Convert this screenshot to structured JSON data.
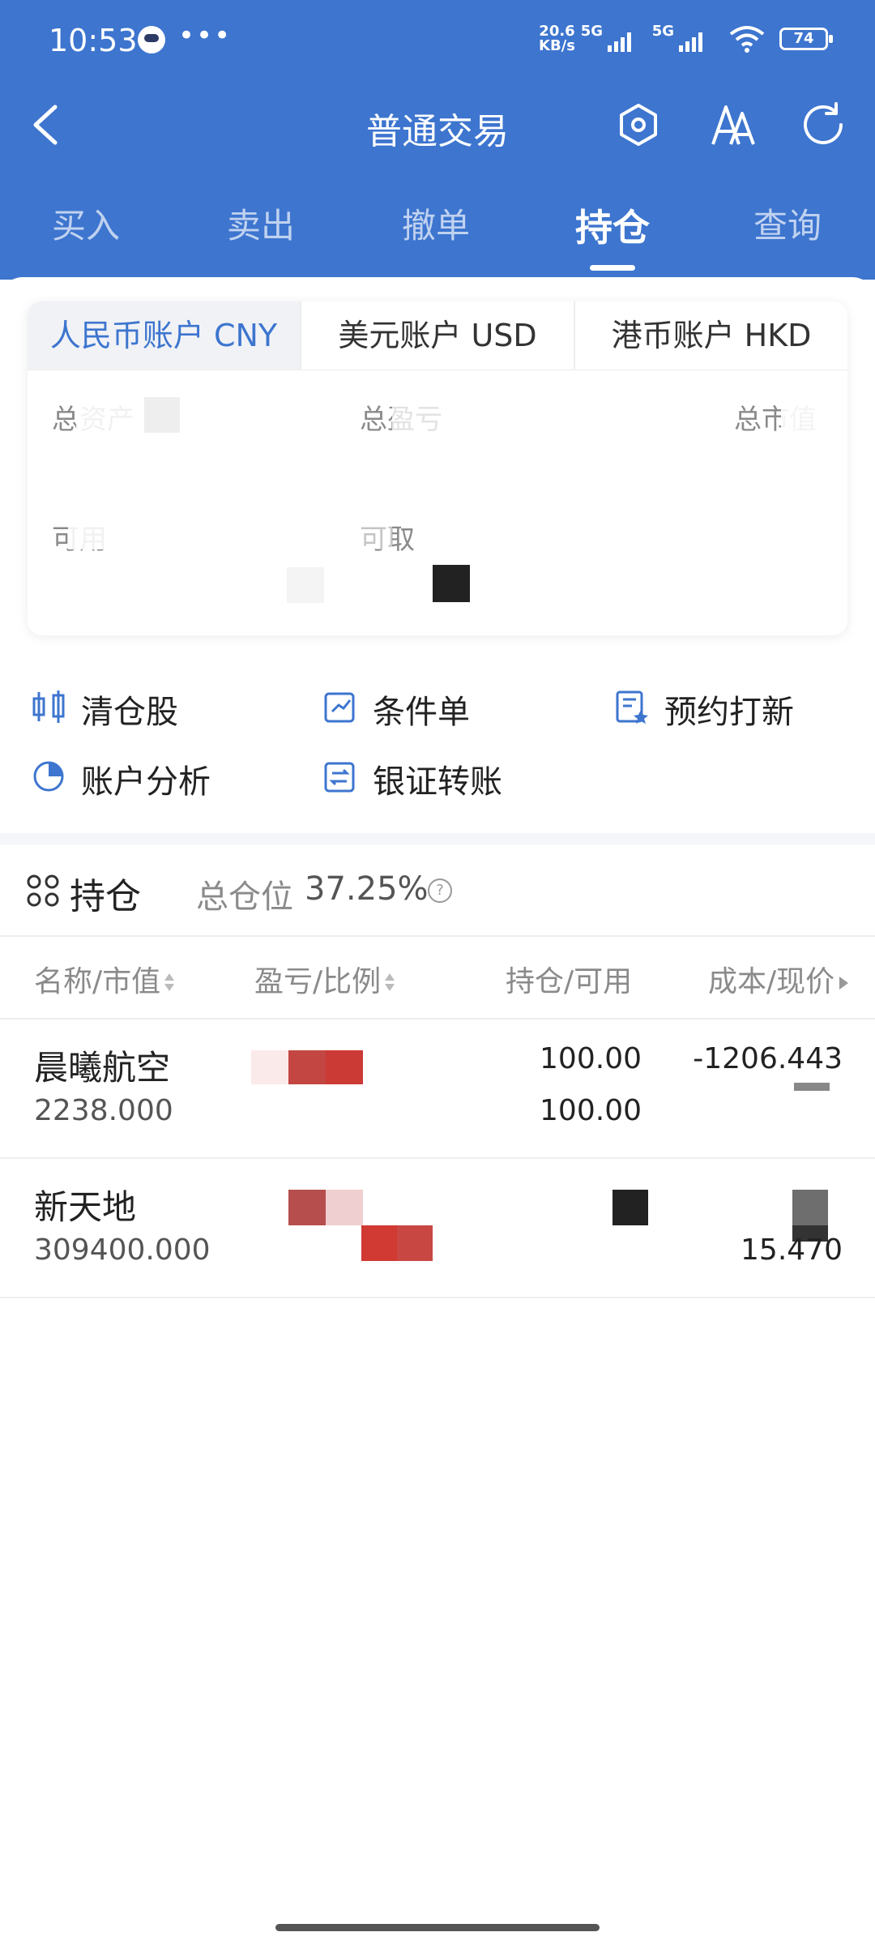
{
  "status_bar": {
    "time": "10:53",
    "net_speed_top": "20.6",
    "net_speed_bottom": "KB/s",
    "sim1": "5G",
    "sim2": "5G",
    "battery": "74"
  },
  "navbar": {
    "title": "普通交易",
    "icons": [
      "back-icon",
      "settings-hexagon-icon",
      "font-size-icon",
      "refresh-icon"
    ]
  },
  "tabs": [
    {
      "label": "买入",
      "active": false
    },
    {
      "label": "卖出",
      "active": false
    },
    {
      "label": "撤单",
      "active": false
    },
    {
      "label": "持仓",
      "active": true
    },
    {
      "label": "查询",
      "active": false
    }
  ],
  "account_tabs": [
    {
      "label": "人民币账户 CNY",
      "active": true
    },
    {
      "label": "美元账户 USD",
      "active": false
    },
    {
      "label": "港币账户 HKD",
      "active": false
    }
  ],
  "account_fields": {
    "total_assets_label": "总资产",
    "total_pnl_label": "总盈亏",
    "market_value_label": "总市值",
    "available_label": "可用",
    "withdrawable_label": "可取"
  },
  "shortcuts": [
    {
      "label": "清仓股",
      "icon": "clear-position-icon"
    },
    {
      "label": "条件单",
      "icon": "conditional-order-icon"
    },
    {
      "label": "预约打新",
      "icon": "ipo-reservation-icon"
    },
    {
      "label": "账户分析",
      "icon": "pie-chart-icon"
    },
    {
      "label": "银证转账",
      "icon": "transfer-icon"
    }
  ],
  "holdings": {
    "title": "持仓",
    "position_label": "总仓位",
    "position_value": "37.25%",
    "columns": [
      "名称/市值",
      "盈亏/比例",
      "持仓/可用",
      "成本/现价"
    ],
    "rows": [
      {
        "name": "晨曦航空",
        "market_value": "2238.000",
        "shares": "100.00",
        "available": "100.00",
        "cost": "-1206.443",
        "price": ""
      },
      {
        "name": "新天地",
        "market_value": "309400.000",
        "shares": "",
        "available": "",
        "cost": "",
        "price": "15.470"
      }
    ]
  },
  "colors": {
    "brand_blue": "#3d75cf",
    "profit_red": "#d03a32",
    "muted_gray": "#8a8a8a"
  }
}
